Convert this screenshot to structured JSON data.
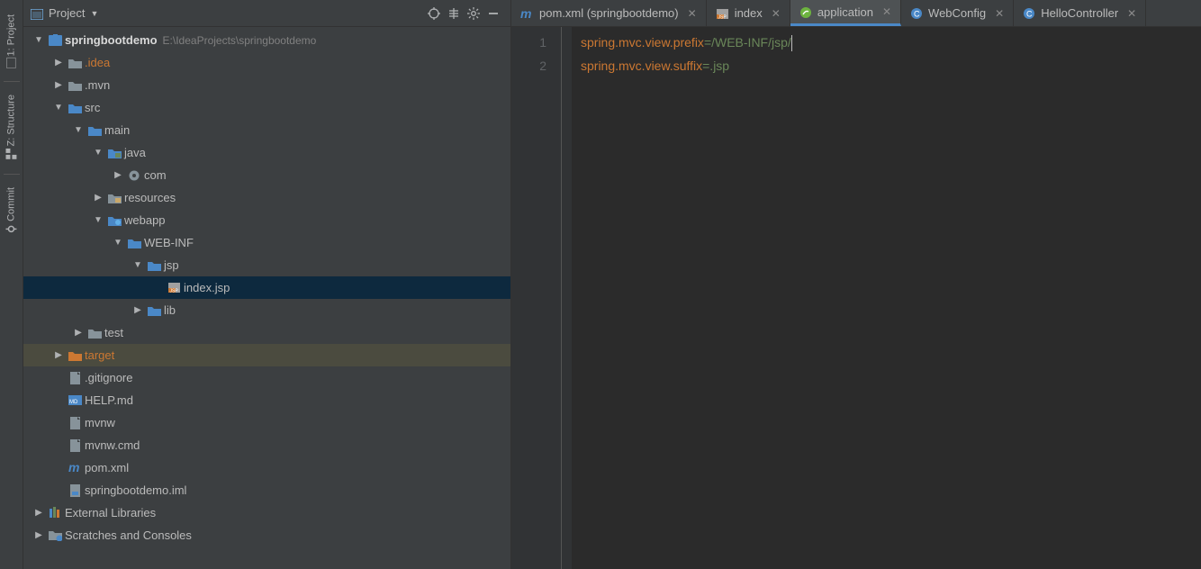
{
  "leftRail": [
    {
      "label": "1: Project",
      "icon": "project"
    },
    {
      "sep": true
    },
    {
      "label": "Z: Structure",
      "icon": "structure"
    },
    {
      "sep": true
    },
    {
      "label": "Commit",
      "icon": "commit"
    }
  ],
  "panel": {
    "title": "Project"
  },
  "tree": [
    {
      "indent": 0,
      "arrow": "down",
      "icon": "module",
      "label": "springbootdemo",
      "bold": true,
      "path": "E:\\IdeaProjects\\springbootdemo"
    },
    {
      "indent": 1,
      "arrow": "right",
      "icon": "folder-gray",
      "label": ".idea",
      "acc": true
    },
    {
      "indent": 1,
      "arrow": "right",
      "icon": "folder-gray",
      "label": ".mvn"
    },
    {
      "indent": 1,
      "arrow": "down",
      "icon": "folder-blue",
      "label": "src"
    },
    {
      "indent": 2,
      "arrow": "down",
      "icon": "folder-blue",
      "label": "main"
    },
    {
      "indent": 3,
      "arrow": "down",
      "icon": "folder-src",
      "label": "java"
    },
    {
      "indent": 4,
      "arrow": "right",
      "icon": "package",
      "label": "com"
    },
    {
      "indent": 3,
      "arrow": "right",
      "icon": "folder-res",
      "label": "resources"
    },
    {
      "indent": 3,
      "arrow": "down",
      "icon": "folder-web",
      "label": "webapp"
    },
    {
      "indent": 4,
      "arrow": "down",
      "icon": "folder-blue",
      "label": "WEB-INF"
    },
    {
      "indent": 5,
      "arrow": "down",
      "icon": "folder-blue",
      "label": "jsp"
    },
    {
      "indent": 6,
      "arrow": "",
      "icon": "jsp",
      "label": "index.jsp",
      "sel": true
    },
    {
      "indent": 5,
      "arrow": "right",
      "icon": "folder-blue",
      "label": "lib"
    },
    {
      "indent": 2,
      "arrow": "right",
      "icon": "folder-gray",
      "label": "test"
    },
    {
      "indent": 1,
      "arrow": "right",
      "icon": "folder-orange",
      "label": "target",
      "acc": true,
      "tgt": true
    },
    {
      "indent": 1,
      "arrow": "",
      "icon": "gitignore",
      "label": ".gitignore"
    },
    {
      "indent": 1,
      "arrow": "",
      "icon": "md",
      "label": "HELP.md"
    },
    {
      "indent": 1,
      "arrow": "",
      "icon": "file",
      "label": "mvnw"
    },
    {
      "indent": 1,
      "arrow": "",
      "icon": "file",
      "label": "mvnw.cmd"
    },
    {
      "indent": 1,
      "arrow": "",
      "icon": "maven",
      "label": "pom.xml"
    },
    {
      "indent": 1,
      "arrow": "",
      "icon": "iml",
      "label": "springbootdemo.iml"
    },
    {
      "indent": 0,
      "arrow": "right",
      "icon": "libs",
      "label": "External Libraries"
    },
    {
      "indent": 0,
      "arrow": "right",
      "icon": "scratch",
      "label": "Scratches and Consoles"
    }
  ],
  "tabs": [
    {
      "icon": "maven",
      "label": "pom.xml (springbootdemo)"
    },
    {
      "icon": "jsp",
      "label": "index"
    },
    {
      "icon": "spring",
      "label": "application",
      "active": true
    },
    {
      "icon": "class",
      "label": "WebConfig"
    },
    {
      "icon": "class",
      "label": "HelloController"
    }
  ],
  "code": {
    "lines": [
      {
        "num": "1",
        "key": "spring.mvc.view.prefix",
        "val": "=/WEB-INF/jsp/",
        "caret": true
      },
      {
        "num": "2",
        "key": "spring.mvc.view.suffix",
        "val": "=.jsp"
      }
    ]
  }
}
